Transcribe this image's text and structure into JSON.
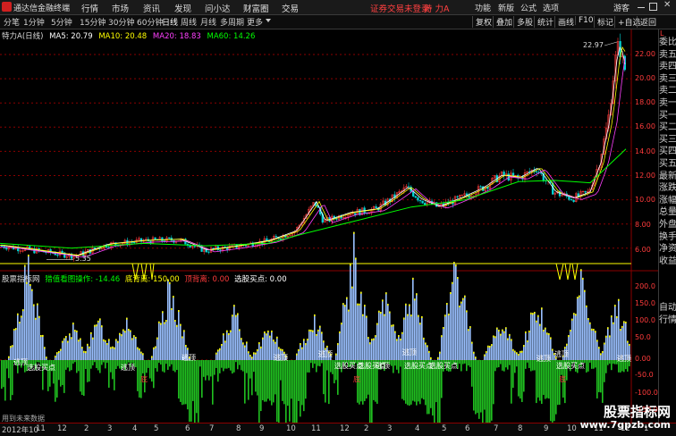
{
  "app": {
    "title": "通达信金融终端"
  },
  "menu": {
    "items": [
      "行情",
      "市场",
      "资讯",
      "发现",
      "问小达",
      "财富圈",
      "交易"
    ]
  },
  "notice": {
    "text": "证券交易未登录",
    "stock": "特 力A"
  },
  "right_menu": {
    "items": [
      "功能",
      "新版",
      "公式",
      "选项",
      "游客"
    ]
  },
  "periods": [
    "分笔",
    "1分钟",
    "5分钟",
    "15分钟",
    "30分钟",
    "60分钟",
    "日线",
    "周线",
    "月线",
    "多周期",
    "更多"
  ],
  "active_period": "日线",
  "tools": [
    "复权",
    "叠加",
    "多股",
    "统计",
    "画线",
    "F10",
    "标记",
    "+自选",
    "返回"
  ],
  "main_chart": {
    "name": "特力A",
    "period": "(日线)",
    "ma5": "MA5: 20.79",
    "ma10": "MA10: 20.48",
    "ma20": "MA20: 18.83",
    "ma60": "MA60: 14.26",
    "high_label": "22.97",
    "low_label": "5.35",
    "y_ticks": [
      "22.00",
      "20.00",
      "18.00",
      "16.00",
      "14.00",
      "12.00",
      "10.00",
      "8.00",
      "6.00"
    ]
  },
  "indicator": {
    "name": "股票指标网",
    "op": "猎值看图操作: -14.46",
    "dbg": "底背离: 150.00",
    "dbl": "顶背离: 0.00",
    "buy": "选股买点: 0.00",
    "y_ticks": [
      "200.0",
      "150.0",
      "100.0",
      "50.0",
      "0.00",
      "-50.0",
      "-100.0",
      "-150.0"
    ],
    "annotations": [
      "逃顶",
      "选股买点",
      "逃顶",
      "逃顶",
      "逃顶",
      "逃顶",
      "选股买点",
      "选股买点",
      "逃顶",
      "逃顶",
      "选股买点",
      "选股买点",
      "逃顶",
      "逃顶",
      "选股买点",
      "逃顶"
    ],
    "bottom_marks": [
      "底",
      "底",
      "底"
    ],
    "footer": "用到未来数据"
  },
  "right_panel": {
    "top": "L",
    "items": [
      "委比",
      "卖五",
      "卖四",
      "卖三",
      "卖二",
      "卖一",
      "买一",
      "买二",
      "买三",
      "买四",
      "买五",
      "最新",
      "涨跌",
      "涨幅",
      "总量",
      "外盘",
      "换手",
      "净资",
      "收益"
    ],
    "bottom": [
      "自动",
      "行情"
    ]
  },
  "dates": [
    "2012年10",
    "11",
    "12",
    "2",
    "3",
    "4",
    "5",
    "6",
    "7",
    "8",
    "9",
    "10",
    "11",
    "12",
    "2",
    "3",
    "4",
    "5",
    "6",
    "7",
    "8",
    "9",
    "10",
    "11",
    "12",
    "1"
  ],
  "watermark": {
    "line1": "股票指标网",
    "line2": "www.7gpzb.com"
  },
  "colors": {
    "up": "#ff3b3b",
    "down": "#00d4d4",
    "ma5": "#ffffff",
    "ma10": "#ffff00",
    "ma20": "#ff40ff",
    "ma60": "#00ff00",
    "grid": "#8b0000",
    "positive_bar": "#9ac0ff",
    "negative_bar": "#20c020",
    "alert": "#ffff00"
  }
}
